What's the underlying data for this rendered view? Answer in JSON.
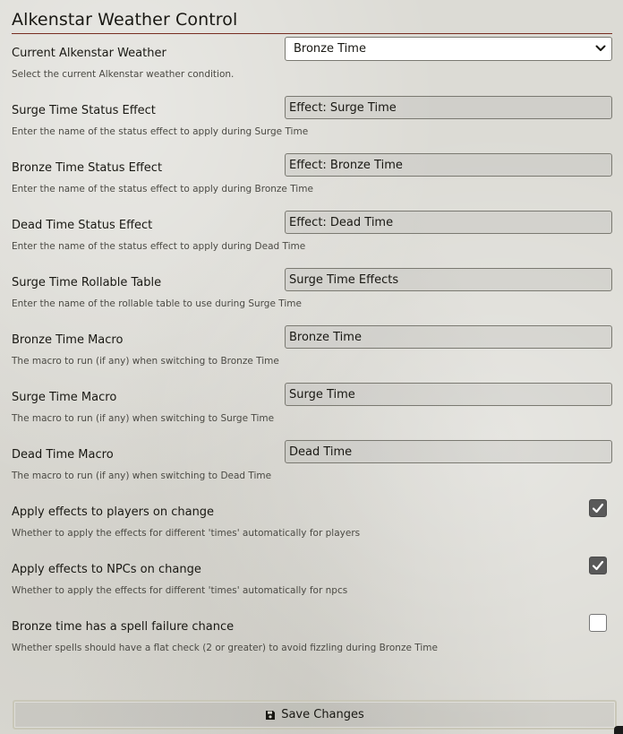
{
  "window": {
    "title": "Alkenstar Weather Control"
  },
  "settings": {
    "current_weather": {
      "label": "Current Alkenstar Weather",
      "notes": "Select the current Alkenstar weather condition.",
      "selected": "Bronze Time"
    },
    "surge_effect": {
      "label": "Surge Time Status Effect",
      "notes": "Enter the name of the status effect to apply during Surge Time",
      "value": "Effect: Surge Time"
    },
    "bronze_effect": {
      "label": "Bronze Time Status Effect",
      "notes": "Enter the name of the status effect to apply during Bronze Time",
      "value": "Effect: Bronze Time"
    },
    "dead_effect": {
      "label": "Dead Time Status Effect",
      "notes": "Enter the name of the status effect to apply during Dead Time",
      "value": "Effect: Dead Time"
    },
    "surge_table": {
      "label": "Surge Time Rollable Table",
      "notes": "Enter the name of the rollable table to use during Surge Time",
      "value": "Surge Time Effects"
    },
    "bronze_macro": {
      "label": "Bronze Time Macro",
      "notes": "The macro to run (if any) when switching to Bronze Time",
      "value": "Bronze Time"
    },
    "surge_macro": {
      "label": "Surge Time Macro",
      "notes": "The macro to run (if any) when switching to Surge Time",
      "value": "Surge Time"
    },
    "dead_macro": {
      "label": "Dead Time Macro",
      "notes": "The macro to run (if any) when switching to Dead Time",
      "value": "Dead Time"
    },
    "apply_players": {
      "label": "Apply effects to players on change",
      "notes": "Whether to apply the effects for different 'times' automatically for players",
      "checked": true
    },
    "apply_npcs": {
      "label": "Apply effects to NPCs on change",
      "notes": "Whether to apply the effects for different 'times' automatically for npcs",
      "checked": true
    },
    "spell_failure": {
      "label": "Bronze time has a spell failure chance",
      "notes": "Whether spells should have a flat check (2 or greater) to avoid fizzling during Bronze Time",
      "checked": false
    }
  },
  "footer": {
    "save_label": "Save Changes",
    "save_icon": "floppy-disk-icon"
  },
  "colors": {
    "title_rule": "#782e22",
    "checkbox_checked": "#595959",
    "text": "#191813"
  }
}
